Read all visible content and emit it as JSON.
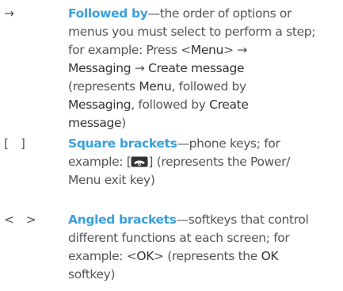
{
  "entries": [
    {
      "symbol": "→",
      "term": "Followed by",
      "dash": "—",
      "lines": [
        [
          "the order of options or"
        ],
        [
          "menus you must select to perform a step;"
        ],
        [
          "for example: Press <",
          "Menu",
          "> →"
        ],
        [
          "Messaging",
          " → ",
          "Create message"
        ],
        [
          "(represents ",
          "Menu",
          ", followed by"
        ],
        [
          "Messaging",
          ", followed by ",
          "Create"
        ],
        [
          "message",
          ")"
        ]
      ]
    },
    {
      "symbol": "[   ]",
      "term": "Square brackets",
      "dash": "—",
      "text_a": "phone keys; for",
      "text_b": "example: [",
      "key_icon": "end-call-power-key-icon",
      "text_c": "] (represents the Power/",
      "text_d": "Menu exit key)"
    },
    {
      "symbol": "<   >",
      "term": "Angled brackets",
      "dash": "—",
      "text_a": "softkeys that control",
      "text_b": "different functions at each screen; for",
      "text_c": "example: <",
      "em_ok": "OK",
      "text_d": "> (represents the ",
      "em_ok2": "OK",
      "text_e": "softkey)"
    }
  ],
  "colors": {
    "accent": "#3aa0dc",
    "body_text": "#555555",
    "emphasis": "#333333"
  }
}
